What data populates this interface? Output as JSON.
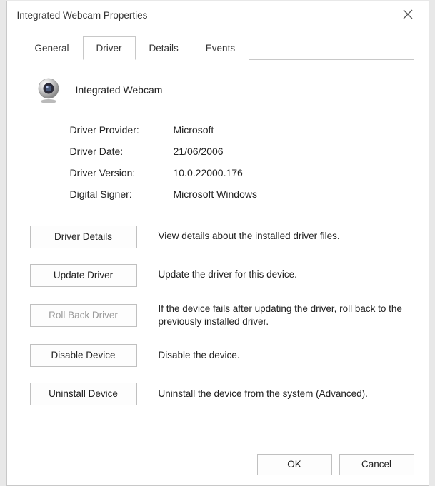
{
  "window": {
    "title": "Integrated Webcam Properties"
  },
  "tabs": [
    {
      "label": "General",
      "active": false
    },
    {
      "label": "Driver",
      "active": true
    },
    {
      "label": "Details",
      "active": false
    },
    {
      "label": "Events",
      "active": false
    }
  ],
  "device": {
    "name": "Integrated Webcam",
    "icon": "webcam-icon"
  },
  "info": {
    "provider_label": "Driver Provider:",
    "provider_value": "Microsoft",
    "date_label": "Driver Date:",
    "date_value": "21/06/2006",
    "version_label": "Driver Version:",
    "version_value": "10.0.22000.176",
    "signer_label": "Digital Signer:",
    "signer_value": "Microsoft Windows"
  },
  "actions": {
    "details": {
      "label": "Driver Details",
      "desc": "View details about the installed driver files.",
      "enabled": true
    },
    "update": {
      "label": "Update Driver",
      "desc": "Update the driver for this device.",
      "enabled": true
    },
    "rollback": {
      "label": "Roll Back Driver",
      "desc": "If the device fails after updating the driver, roll back to the previously installed driver.",
      "enabled": false
    },
    "disable": {
      "label": "Disable Device",
      "desc": "Disable the device.",
      "enabled": true
    },
    "uninstall": {
      "label": "Uninstall Device",
      "desc": "Uninstall the device from the system (Advanced).",
      "enabled": true
    }
  },
  "footer": {
    "ok_label": "OK",
    "cancel_label": "Cancel"
  }
}
